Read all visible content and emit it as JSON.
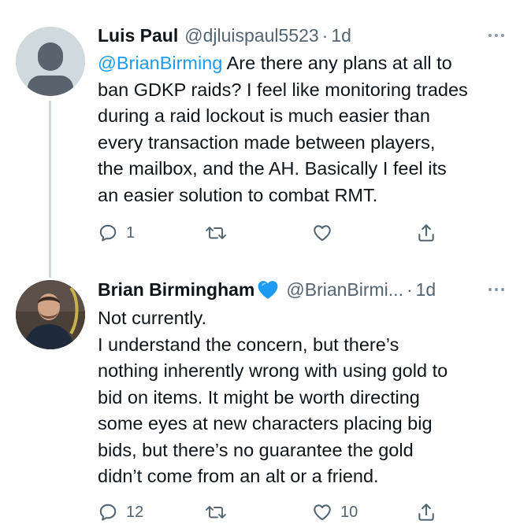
{
  "tweets": [
    {
      "author_name": "Luis Paul",
      "handle": "@djluispaul5523",
      "separator": "·",
      "time": "1d",
      "mention": "@BrianBirming",
      "first_line_rest": " Are there any plans at all to",
      "lines": [
        "ban GDKP raids? I feel like monitoring trades",
        "during a raid lockout is much easier than",
        "every transaction made between players,",
        "the mailbox, and the AH. Basically I feel its",
        "an easier solution to combat RMT."
      ],
      "reply_count": "1",
      "retweet_count": "",
      "like_count": ""
    },
    {
      "author_name": "Brian Birmingham",
      "handle": "@BrianBirmi...",
      "separator": "·",
      "time": "1d",
      "lines": [
        "Not currently.",
        "I understand the concern, but there’s",
        "nothing inherently wrong with using gold to",
        "bid on items.  It might be worth directing",
        "some eyes at new characters placing big",
        "bids, but there’s no guarantee the gold",
        "didn’t come from an alt or a friend."
      ],
      "reply_count": "12",
      "retweet_count": "",
      "like_count": "10"
    }
  ],
  "icons": {
    "reply": "reply-icon",
    "retweet": "retweet-icon",
    "like": "heart-icon",
    "share": "share-icon",
    "more": "more-icon",
    "verified": "blue-heart-icon"
  },
  "colors": {
    "link": "#1d9bf0",
    "muted": "#536471",
    "text": "#0f1419",
    "heart": "#1d9bf0"
  }
}
